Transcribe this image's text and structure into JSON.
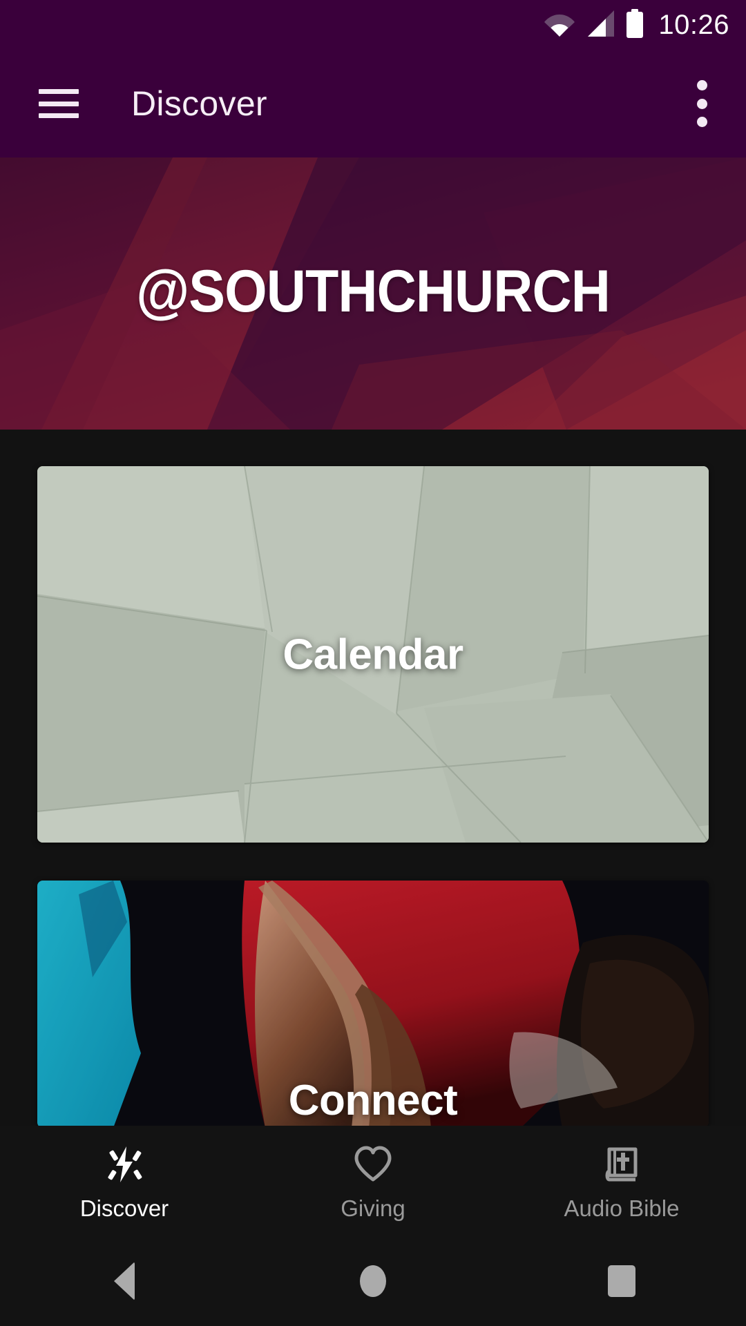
{
  "status_bar": {
    "time": "10:26",
    "icons": [
      "wifi-icon",
      "cellular-signal-icon",
      "battery-full-icon"
    ],
    "background_color": "#3A003B",
    "foreground_color": "#FFFFFF"
  },
  "app_bar": {
    "menu_icon": "hamburger-menu-icon",
    "title": "Discover",
    "overflow_icon": "more-vertical-icon",
    "background_color": "#3A003B",
    "text_color": "#F6EEF6"
  },
  "hero": {
    "title": "@SOUTHCHURCH",
    "background_colors": [
      "#3B0B34",
      "#6E1338",
      "#8A2233",
      "#2C0730"
    ],
    "text_color": "#FFFFFF"
  },
  "cards": [
    {
      "label": "Calendar",
      "image": "stacked-sage-paper-sheets",
      "base_color": "#B6BFB2",
      "text_color": "#FFFFFF"
    },
    {
      "label": "Connect",
      "image": "two-hands-touching-palms",
      "base_color": "#0A0A10",
      "accent_colors": [
        "#18B6D8",
        "#C8192B"
      ],
      "text_color": "#FFFFFF"
    }
  ],
  "tab_bar": {
    "background_color": "#131313",
    "active_color": "#FFFFFF",
    "inactive_color": "#9A9A9A",
    "tabs": [
      {
        "label": "Discover",
        "icon": "flash-sparkle-icon",
        "active": true
      },
      {
        "label": "Giving",
        "icon": "heart-outline-icon",
        "active": false
      },
      {
        "label": "Audio Bible",
        "icon": "bible-book-icon",
        "active": false
      }
    ]
  },
  "nav_bar": {
    "background_color": "#131313",
    "icon_color": "#ABABAB",
    "buttons": [
      {
        "name": "back",
        "icon": "triangle-back-icon"
      },
      {
        "name": "home",
        "icon": "circle-home-icon"
      },
      {
        "name": "recent",
        "icon": "square-recents-icon"
      }
    ]
  }
}
